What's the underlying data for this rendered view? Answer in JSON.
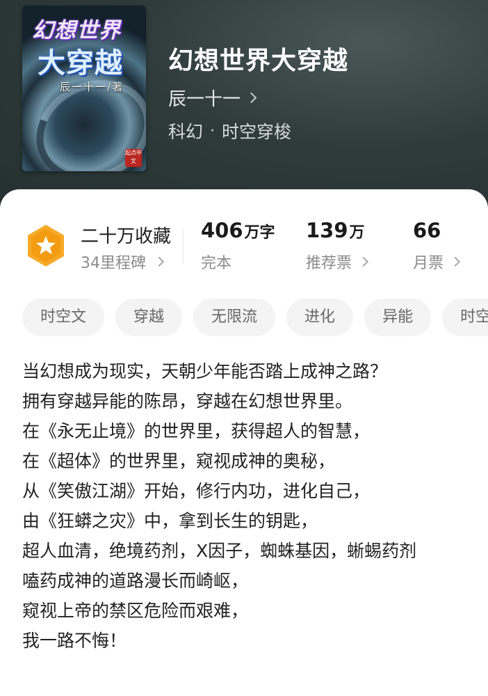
{
  "book": {
    "title": "幻想世界大穿越",
    "author": "辰一十一",
    "category": "科幻",
    "subcategory": "时空穿梭",
    "category_separator": "·"
  },
  "cover": {
    "title_line1": "幻想世界",
    "title_line2": "大穿越",
    "author_text": "辰一十一/著",
    "publisher_badge": "起点中文"
  },
  "award": {
    "title": "二十万收藏",
    "subtitle": "34里程碑",
    "icon": "star-badge-icon",
    "color": "#f5a623"
  },
  "stats": [
    {
      "value": "406",
      "unit": "万字",
      "label": "完本",
      "has_arrow": false
    },
    {
      "value": "139",
      "unit": "万",
      "label": "推荐票",
      "has_arrow": true
    },
    {
      "value": "66",
      "unit": "",
      "label": "月票",
      "has_arrow": true
    }
  ],
  "tags": [
    "时空文",
    "穿越",
    "无限流",
    "进化",
    "异能",
    "时空"
  ],
  "description": [
    "当幻想成为现实，天朝少年能否踏上成神之路？",
    "拥有穿越异能的陈昂，穿越在幻想世界里。",
    "在《永无止境》的世界里，获得超人的智慧，",
    "在《超体》的世界里，窥视成神的奥秘，",
    "从《笑傲江湖》开始，修行内功，进化自己，",
    "由《狂蟒之灾》中，拿到长生的钥匙，",
    "超人血清，绝境药剂，X因子，蜘蛛基因，蜥蜴药剂",
    "嗑药成神的道路漫长而崎岖，",
    "窥视上帝的禁区危险而艰难，",
    "我一路不悔！"
  ]
}
